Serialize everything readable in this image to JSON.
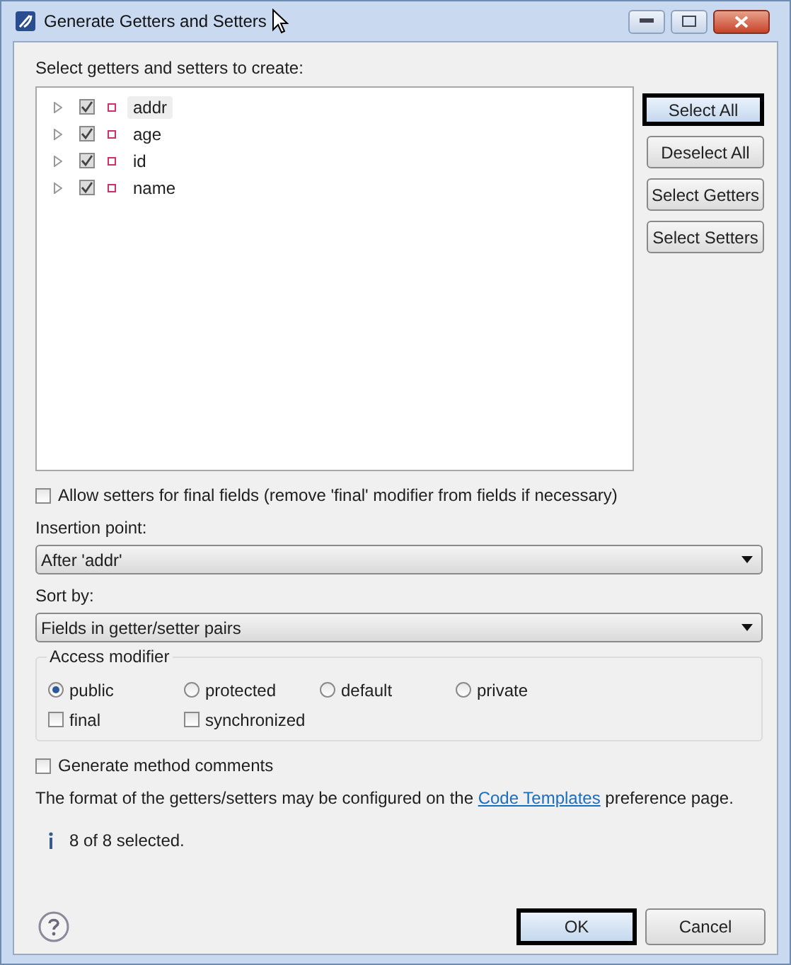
{
  "window": {
    "title": "Generate Getters and Setters"
  },
  "instruction": "Select getters and setters to create:",
  "fields": [
    {
      "name": "addr",
      "checked": true,
      "selected": true
    },
    {
      "name": "age",
      "checked": true,
      "selected": false
    },
    {
      "name": "id",
      "checked": true,
      "selected": false
    },
    {
      "name": "name",
      "checked": true,
      "selected": false
    }
  ],
  "side_buttons": [
    {
      "label": "Select All",
      "focused": true
    },
    {
      "label": "Deselect All",
      "focused": false
    },
    {
      "label": "Select Getters",
      "focused": false
    },
    {
      "label": "Select Setters",
      "focused": false
    }
  ],
  "allow_final": {
    "label": "Allow setters for final fields (remove 'final' modifier from fields if necessary)",
    "checked": false
  },
  "insertion_point": {
    "label": "Insertion point:",
    "value": "After 'addr'"
  },
  "sort_by": {
    "label": "Sort by:",
    "value": "Fields in getter/setter pairs"
  },
  "access_modifier": {
    "title": "Access modifier",
    "visibility": [
      {
        "label": "public",
        "selected": true
      },
      {
        "label": "protected",
        "selected": false
      },
      {
        "label": "default",
        "selected": false
      },
      {
        "label": "private",
        "selected": false
      }
    ],
    "modifiers": [
      {
        "label": "final",
        "checked": false
      },
      {
        "label": "synchronized",
        "checked": false
      }
    ]
  },
  "generate_comments": {
    "label": "Generate method comments",
    "checked": false
  },
  "note": {
    "before": "The format of the getters/setters may be configured on the",
    "link": "Code Templates",
    "after": "preference page."
  },
  "status": "8 of 8 selected.",
  "footer_buttons": [
    {
      "label": "OK",
      "focused": true
    },
    {
      "label": "Cancel",
      "focused": false
    }
  ]
}
